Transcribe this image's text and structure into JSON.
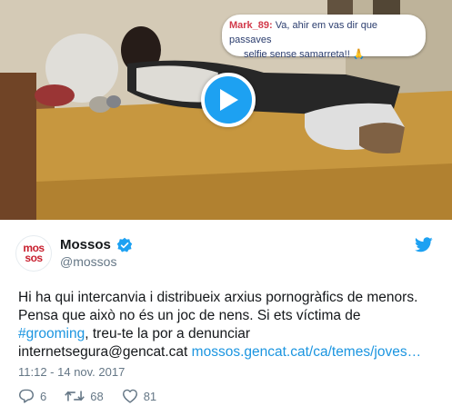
{
  "video": {
    "overlay_bubble": {
      "handle": "Mark_89:",
      "message_line1": " Va, ahir em vas dir que passaves",
      "message_line2": "selfie sense samarreta!! ",
      "emoji": "🙏"
    },
    "play_button_icon": "play-icon"
  },
  "tweet": {
    "avatar": {
      "line1": "mos",
      "line2": "sos"
    },
    "display_name": "Mossos",
    "verified": true,
    "username": "@mossos",
    "body": {
      "line1": "Hi ha qui intercanvia i distribueix arxius pornogràfics de menors.",
      "line2": "Pensa que això no és un joc de nens. Si ets víctima de",
      "hashtag": "#grooming",
      "line3_rest": ", treu-te la por a denunciar",
      "email": "internetsegura@gencat.cat",
      "url": "mossos.gencat.cat/ca/temes/joves…"
    },
    "timestamp": "11:12 - 14 nov. 2017",
    "actions": {
      "replies": "6",
      "retweets": "68",
      "likes": "81"
    }
  },
  "colors": {
    "twitter_blue": "#1da1f2",
    "link": "#1b95e0",
    "muted": "#657786",
    "brand_red": "#c8202f"
  }
}
